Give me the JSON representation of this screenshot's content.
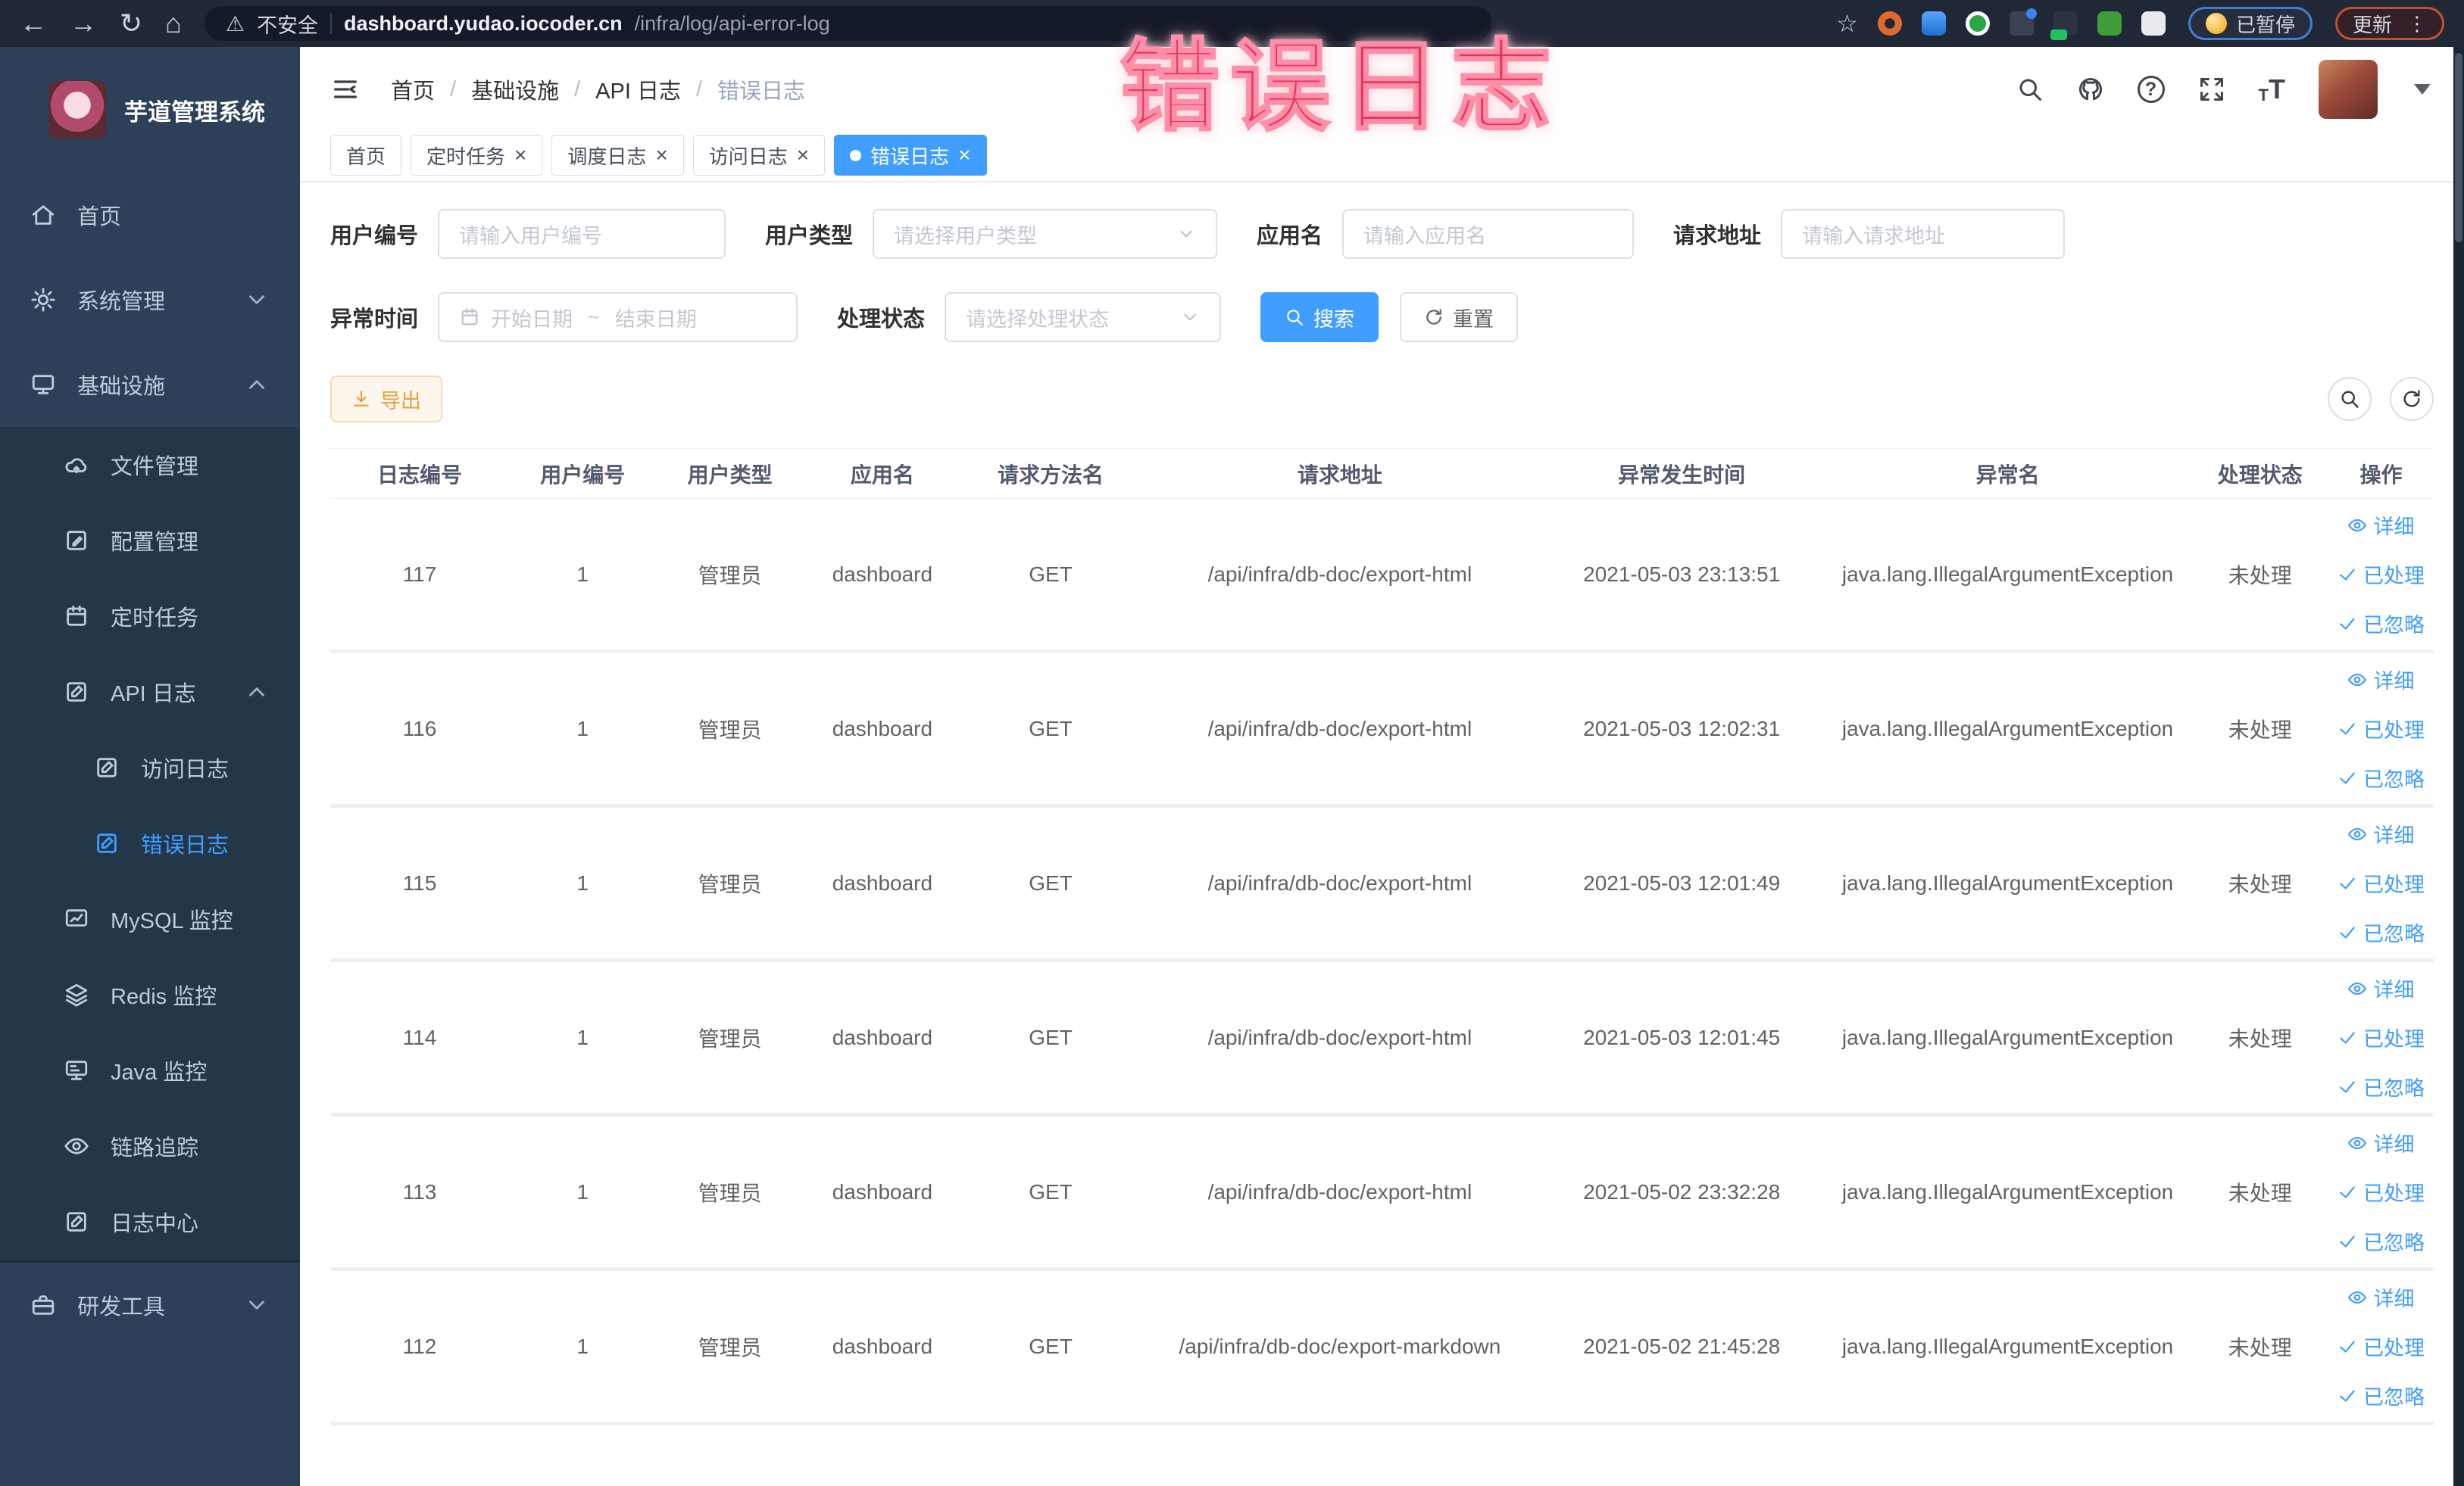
{
  "browser": {
    "security_label": "不安全",
    "url_host": "dashboard.yudao.iocoder.cn",
    "url_path": "/infra/log/api-error-log",
    "paused_badge": "已暂停",
    "update_button": "更新"
  },
  "annotation": {
    "text": "错误日志"
  },
  "colors": {
    "accent": "#409eff",
    "warning": "#e6a23c",
    "annotation_pink": "#e8335f",
    "sidebar_bg": "#2c4158",
    "sidebar_submenu_bg": "#233749",
    "browser_bar_bg": "#202737"
  },
  "sidebar": {
    "logo_title": "芋道管理系统",
    "menu": [
      {
        "label": "首页",
        "icon": "home",
        "level": 0
      },
      {
        "label": "系统管理",
        "icon": "gear",
        "level": 0,
        "chevron": "down"
      },
      {
        "label": "基础设施",
        "icon": "infra",
        "level": 0,
        "chevron": "up"
      },
      {
        "label": "文件管理",
        "icon": "cloud",
        "level": 1
      },
      {
        "label": "配置管理",
        "icon": "edit",
        "level": 1
      },
      {
        "label": "定时任务",
        "icon": "timer",
        "level": 1
      },
      {
        "label": "API 日志",
        "icon": "log",
        "level": 1,
        "chevron": "up"
      },
      {
        "label": "访问日志",
        "icon": "log",
        "level": 2
      },
      {
        "label": "错误日志",
        "icon": "log",
        "level": 2,
        "active": true
      },
      {
        "label": "MySQL 监控",
        "icon": "chart",
        "level": 1
      },
      {
        "label": "Redis 监控",
        "icon": "layers",
        "level": 1
      },
      {
        "label": "Java 监控",
        "icon": "java",
        "level": 1
      },
      {
        "label": "链路追踪",
        "icon": "eye",
        "level": 1
      },
      {
        "label": "日志中心",
        "icon": "log",
        "level": 1
      },
      {
        "label": "研发工具",
        "icon": "tools",
        "level": 0,
        "chevron": "down",
        "divider": true
      }
    ]
  },
  "header": {
    "breadcrumb": [
      "首页",
      "基础设施",
      "API 日志",
      "错误日志"
    ]
  },
  "tabs": [
    {
      "label": "首页",
      "closable": false,
      "active": false
    },
    {
      "label": "定时任务",
      "closable": true,
      "active": false
    },
    {
      "label": "调度日志",
      "closable": true,
      "active": false
    },
    {
      "label": "访问日志",
      "closable": true,
      "active": false
    },
    {
      "label": "错误日志",
      "closable": true,
      "active": true
    }
  ],
  "filters": {
    "user_id": {
      "label": "用户编号",
      "placeholder": "请输入用户编号"
    },
    "user_type": {
      "label": "用户类型",
      "placeholder": "请选择用户类型"
    },
    "app_name": {
      "label": "应用名",
      "placeholder": "请输入应用名"
    },
    "request_url": {
      "label": "请求地址",
      "placeholder": "请输入请求地址"
    },
    "exception_time": {
      "label": "异常时间",
      "start_placeholder": "开始日期",
      "separator": "~",
      "end_placeholder": "结束日期"
    },
    "process_status": {
      "label": "处理状态",
      "placeholder": "请选择处理状态"
    },
    "search_button": "搜索",
    "reset_button": "重置"
  },
  "toolbar": {
    "export_button": "导出"
  },
  "table": {
    "columns": [
      "日志编号",
      "用户编号",
      "用户类型",
      "应用名",
      "请求方法名",
      "请求地址",
      "异常发生时间",
      "异常名",
      "处理状态",
      "操作"
    ],
    "actions": [
      "详细",
      "已处理",
      "已忽略"
    ],
    "rows": [
      {
        "id": "117",
        "user_id": "1",
        "user_type": "管理员",
        "app": "dashboard",
        "method": "GET",
        "url": "/api/infra/db-doc/export-html",
        "time": "2021-05-03 23:13:51",
        "exception": "java.lang.IllegalArgumentException",
        "status": "未处理"
      },
      {
        "id": "116",
        "user_id": "1",
        "user_type": "管理员",
        "app": "dashboard",
        "method": "GET",
        "url": "/api/infra/db-doc/export-html",
        "time": "2021-05-03 12:02:31",
        "exception": "java.lang.IllegalArgumentException",
        "status": "未处理"
      },
      {
        "id": "115",
        "user_id": "1",
        "user_type": "管理员",
        "app": "dashboard",
        "method": "GET",
        "url": "/api/infra/db-doc/export-html",
        "time": "2021-05-03 12:01:49",
        "exception": "java.lang.IllegalArgumentException",
        "status": "未处理"
      },
      {
        "id": "114",
        "user_id": "1",
        "user_type": "管理员",
        "app": "dashboard",
        "method": "GET",
        "url": "/api/infra/db-doc/export-html",
        "time": "2021-05-03 12:01:45",
        "exception": "java.lang.IllegalArgumentException",
        "status": "未处理"
      },
      {
        "id": "113",
        "user_id": "1",
        "user_type": "管理员",
        "app": "dashboard",
        "method": "GET",
        "url": "/api/infra/db-doc/export-html",
        "time": "2021-05-02 23:32:28",
        "exception": "java.lang.IllegalArgumentException",
        "status": "未处理"
      },
      {
        "id": "112",
        "user_id": "1",
        "user_type": "管理员",
        "app": "dashboard",
        "method": "GET",
        "url": "/api/infra/db-doc/export-markdown",
        "time": "2021-05-02 21:45:28",
        "exception": "java.lang.IllegalArgumentException",
        "status": "未处理"
      }
    ]
  }
}
